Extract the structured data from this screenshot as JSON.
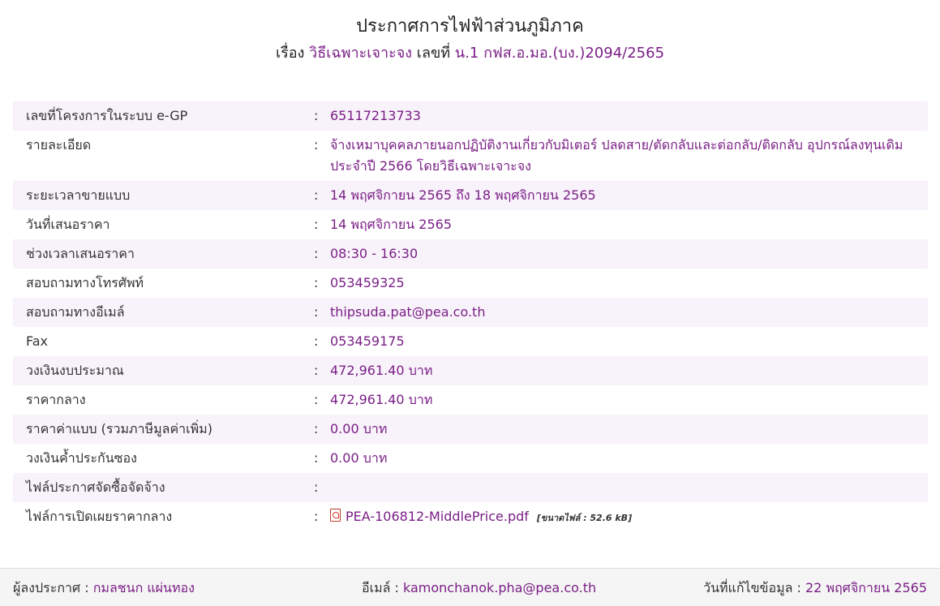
{
  "header": {
    "title": "ประกาศการไฟฟ้าส่วนภูมิภาค",
    "subject_prefix": "เรื่อง",
    "subject": "วิธีเฉพาะเจาะจง",
    "number_prefix": "เลขที่",
    "number": "น.1 กฟส.อ.มอ.(บง.)2094/2565"
  },
  "details": {
    "egp_label": "เลขที่โครงการในระบบ e-GP",
    "egp_value": "65117213733",
    "detail_label": "รายละเอียด",
    "detail_value": "จ้างเหมาบุคคลภายนอกปฏิบัติงานเกี่ยวกับมิเตอร์ ปลดสาย/ตัดกลับและต่อกลับ/ติดกลับ อุปกรณ์ลงทุนเดิม ประจำปี 2566 โดยวิธีเฉพาะเจาะจง",
    "sale_period_label": "ระยะเวลาขายแบบ",
    "sale_period_value": "14 พฤศจิกายน 2565 ถึง 18 พฤศจิกายน 2565",
    "bid_date_label": "วันที่เสนอราคา",
    "bid_date_value": "14 พฤศจิกายน 2565",
    "bid_time_label": "ช่วงเวลาเสนอราคา",
    "bid_time_value": "08:30 - 16:30",
    "phone_label": "สอบถามทางโทรศัพท์",
    "phone_value": "053459325",
    "email_label": "สอบถามทางอีเมล์",
    "email_value": "thipsuda.pat@pea.co.th",
    "fax_label": "Fax",
    "fax_value": "053459175",
    "budget_label": "วงเงินงบประมาณ",
    "budget_value": "472,961.40 บาท",
    "middle_price_label": "ราคากลาง",
    "middle_price_value": "472,961.40 บาท",
    "doc_price_label": "ราคาค่าแบบ (รวมภาษีมูลค่าเพิ่ม)",
    "doc_price_value": "0.00 บาท",
    "guarantee_label": "วงเงินค้ำประกันซอง",
    "guarantee_value": "0.00 บาท",
    "announce_file_label": "ไฟล์ประกาศจัดซื้อจัดจ้าง",
    "announce_file_value": "",
    "middle_price_file_label": "ไฟล์การเปิดเผยราคากลาง",
    "middle_price_file_name": "PEA-106812-MiddlePrice.pdf",
    "middle_price_file_size": "[ขนาดไฟล์ : 52.6 kB]"
  },
  "footer": {
    "announcer_label": "ผู้ลงประกาศ :",
    "announcer_value": "กมลชนก แผ่นทอง",
    "email_label": "อีเมล์ :",
    "email_value": "kamonchanok.pha@pea.co.th",
    "updated_label": "วันที่แก้ไขข้อมูล :",
    "updated_value": "22 พฤศจิกายน 2565"
  },
  "colors": {
    "accent": "#7a1f86",
    "stripe": "#f8f2fa"
  },
  "icons": {
    "file_icon": "pdf-file-icon"
  }
}
